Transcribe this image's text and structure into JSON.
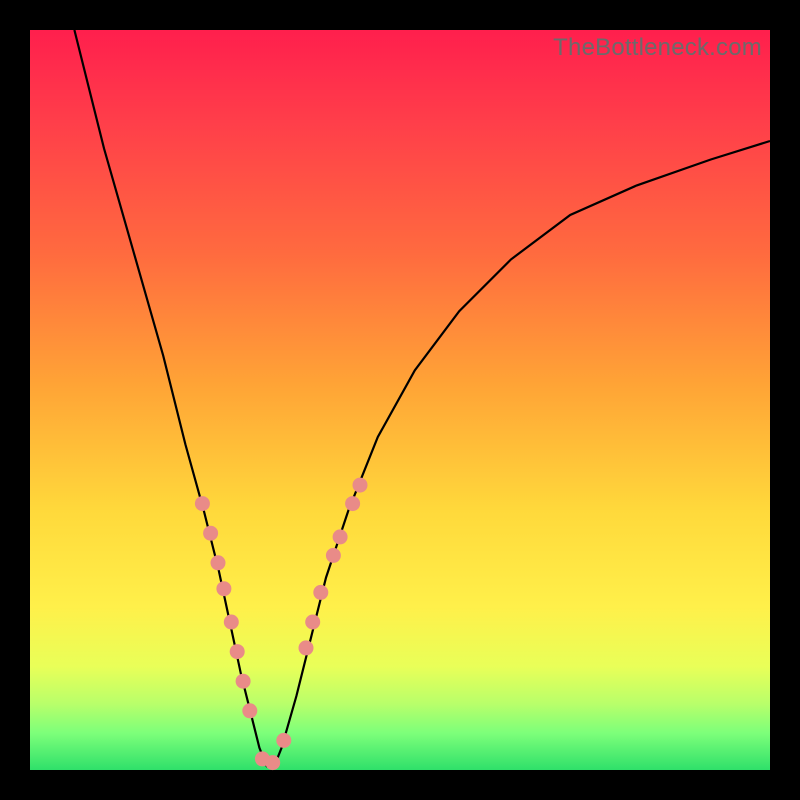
{
  "watermark": "TheBottleneck.com",
  "colors": {
    "frame": "#000000",
    "dot": "#e98b88",
    "curve": "#000000",
    "gradient_top": "#ff1f4d",
    "gradient_bottom": "#2fe06a"
  },
  "chart_data": {
    "type": "line",
    "title": "",
    "xlabel": "",
    "ylabel": "",
    "xlim": [
      0,
      100
    ],
    "ylim": [
      0,
      100
    ],
    "note": "No axis ticks or numeric labels are shown; x and y values below are normalized 0–100 estimates from pixel positions within the plot area.",
    "series": [
      {
        "name": "curve",
        "x": [
          6,
          10,
          14,
          18,
          21,
          23.5,
          25.5,
          27,
          28.5,
          30,
          31,
          32,
          33,
          34,
          36,
          38,
          40,
          43,
          47,
          52,
          58,
          65,
          73,
          82,
          92,
          100
        ],
        "y": [
          100,
          84,
          70,
          56,
          44,
          35,
          27,
          20,
          13,
          7,
          3,
          0.5,
          0.5,
          3,
          10,
          18,
          26,
          35,
          45,
          54,
          62,
          69,
          75,
          79,
          82.5,
          85
        ]
      }
    ],
    "marker_points": {
      "name": "highlighted-dots",
      "x": [
        23.3,
        24.4,
        25.4,
        26.2,
        27.2,
        28.0,
        28.8,
        29.7,
        31.4,
        32.8,
        34.3,
        37.3,
        38.2,
        39.3,
        41.0,
        41.9,
        43.6,
        44.6
      ],
      "y": [
        36.0,
        32.0,
        28.0,
        24.5,
        20.0,
        16.0,
        12.0,
        8.0,
        1.5,
        1.0,
        4.0,
        16.5,
        20.0,
        24.0,
        29.0,
        31.5,
        36.0,
        38.5
      ]
    }
  }
}
